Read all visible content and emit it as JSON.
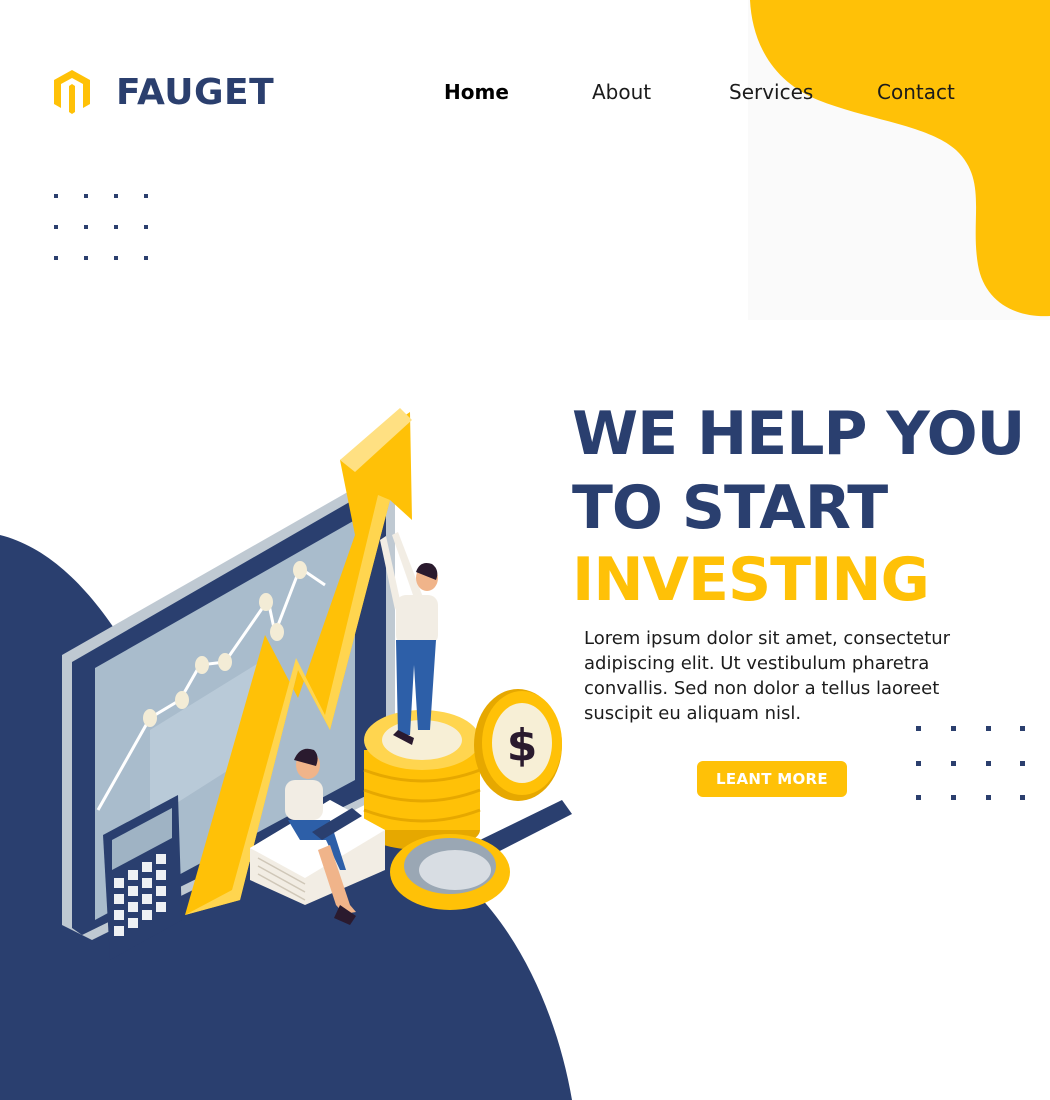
{
  "brand": {
    "name": "FAUGET",
    "logo_icon": "magento-style-logo-icon"
  },
  "nav": {
    "items": [
      {
        "label": "Home",
        "active": true
      },
      {
        "label": "About",
        "active": false
      },
      {
        "label": "Services",
        "active": false
      },
      {
        "label": "Contact",
        "active": false
      }
    ]
  },
  "hero": {
    "line1": "WE HELP YOU",
    "line2": "TO START",
    "line3": "INVESTING",
    "description": "Lorem ipsum dolor sit amet, consectetur adipiscing elit. Ut vestibulum pharetra convallis. Sed non dolor a tellus laoreet suscipit eu aliquam nisl.",
    "cta_label": "LEANT MORE"
  },
  "colors": {
    "navy": "#2a3f6f",
    "gold": "#ffc107",
    "background": "#ffffff"
  }
}
